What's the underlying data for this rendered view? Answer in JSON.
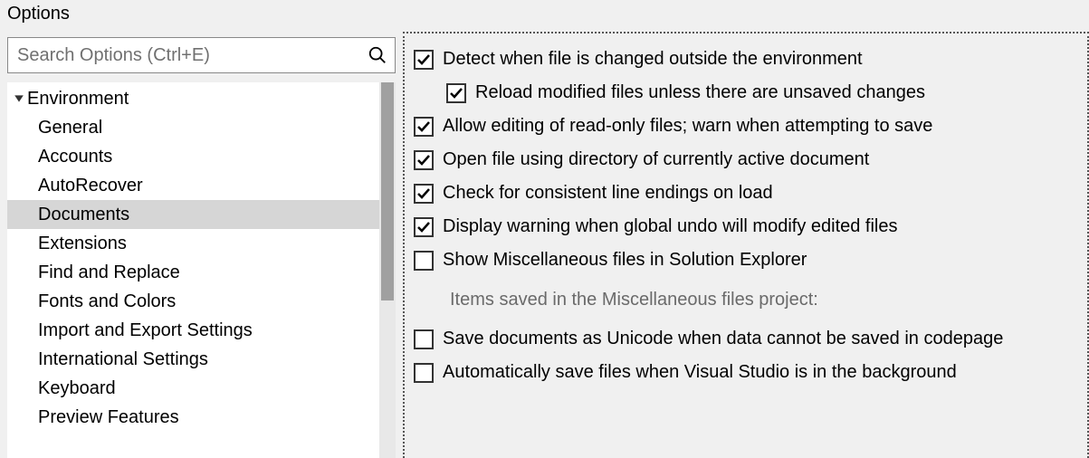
{
  "window": {
    "title": "Options"
  },
  "search": {
    "placeholder": "Search Options (Ctrl+E)"
  },
  "tree": {
    "category": "Environment",
    "items": [
      {
        "label": "General",
        "selected": false
      },
      {
        "label": "Accounts",
        "selected": false
      },
      {
        "label": "AutoRecover",
        "selected": false
      },
      {
        "label": "Documents",
        "selected": true
      },
      {
        "label": "Extensions",
        "selected": false
      },
      {
        "label": "Find and Replace",
        "selected": false
      },
      {
        "label": "Fonts and Colors",
        "selected": false
      },
      {
        "label": "Import and Export Settings",
        "selected": false
      },
      {
        "label": "International Settings",
        "selected": false
      },
      {
        "label": "Keyboard",
        "selected": false
      },
      {
        "label": "Preview Features",
        "selected": false
      }
    ]
  },
  "options": {
    "rows": [
      {
        "checked": true,
        "indent": 1,
        "label": "Detect when file is changed outside the environment"
      },
      {
        "checked": true,
        "indent": 2,
        "label": "Reload modified files unless there are unsaved changes"
      },
      {
        "checked": true,
        "indent": 1,
        "label": "Allow editing of read-only files; warn when attempting to save"
      },
      {
        "checked": true,
        "indent": 1,
        "label": "Open file using directory of currently active document"
      },
      {
        "checked": true,
        "indent": 1,
        "label": "Check for consistent line endings on load"
      },
      {
        "checked": true,
        "indent": 1,
        "label": "Display warning when global undo will modify edited files"
      },
      {
        "checked": false,
        "indent": 1,
        "label": "Show Miscellaneous files in Solution Explorer"
      }
    ],
    "sub_label": "Items saved in the Miscellaneous files project:",
    "rows2": [
      {
        "checked": false,
        "indent": 1,
        "label": "Save documents as Unicode when data cannot be saved in codepage"
      },
      {
        "checked": false,
        "indent": 1,
        "label": "Automatically save files when Visual Studio is in the background"
      }
    ]
  }
}
